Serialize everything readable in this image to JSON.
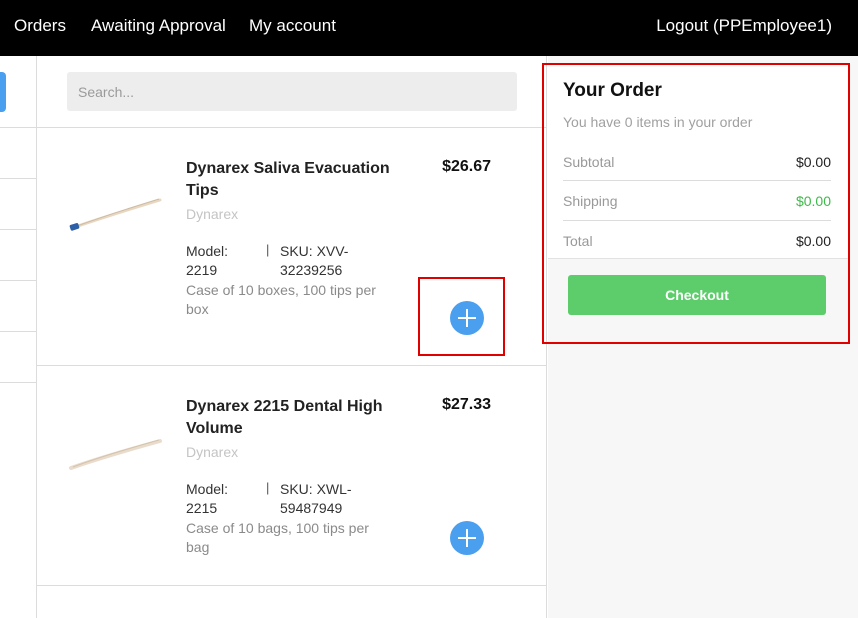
{
  "nav": {
    "orders": "Orders",
    "awaiting_approval": "Awaiting Approval",
    "my_account": "My account",
    "logout": "Logout (PPEmployee1)"
  },
  "search": {
    "placeholder": "Search..."
  },
  "products": [
    {
      "name": "Dynarex Saliva Evacuation Tips",
      "brand": "Dynarex",
      "model": "Model: 2219",
      "separator": "|",
      "sku": "SKU: XVV-32239256",
      "description": "Case of 10 boxes, 100 tips per box",
      "price": "$26.67",
      "thumbnail_icon": "saliva-ejector-tip-image"
    },
    {
      "name": "Dynarex 2215 Dental High Volume",
      "brand": "Dynarex",
      "model": "Model: 2215",
      "separator": "|",
      "sku": "SKU: XWL-59487949",
      "description": "Case of 10 bags, 100 tips per bag",
      "price": "$27.33",
      "thumbnail_icon": "high-volume-tip-image"
    }
  ],
  "order": {
    "title": "Your Order",
    "subtitle": "You have 0 items in your order",
    "subtotal_label": "Subtotal",
    "subtotal_value": "$0.00",
    "shipping_label": "Shipping",
    "shipping_value": "$0.00",
    "total_label": "Total",
    "total_value": "$0.00",
    "checkout_label": "Checkout"
  },
  "colors": {
    "accent_blue": "#4a9fee",
    "checkout_green": "#5ccd6a",
    "shipping_green": "#3fb94a",
    "highlight_red": "#e00000",
    "nav_bg": "#000000"
  }
}
